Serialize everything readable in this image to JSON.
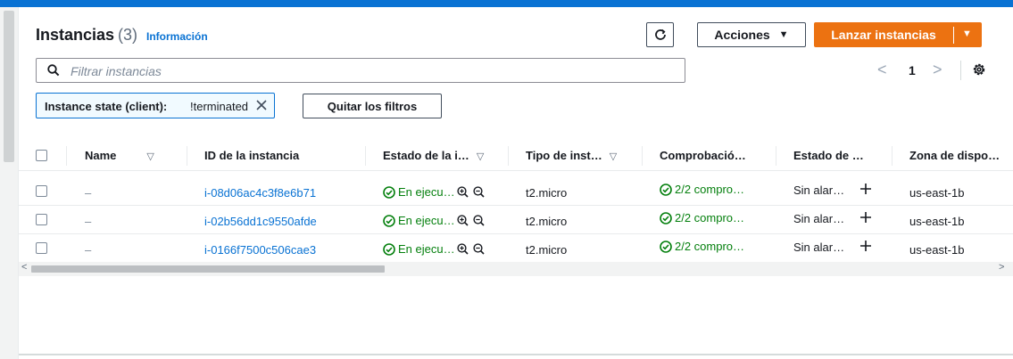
{
  "header": {
    "title": "Instancias",
    "count": "(3)",
    "info_link": "Información"
  },
  "toolbar": {
    "refresh_icon": "refresh-icon",
    "actions_label": "Acciones",
    "launch_label": "Lanzar instancias"
  },
  "search": {
    "placeholder": "Filtrar instancias",
    "value": ""
  },
  "pagination": {
    "current_page": "1"
  },
  "filter_token": {
    "key": "Instance state (client):",
    "value": "!terminated"
  },
  "clear_filters_label": "Quitar los filtros",
  "table": {
    "columns": [
      {
        "label": "Name"
      },
      {
        "label": "ID de la instancia"
      },
      {
        "label": "Estado de la i…"
      },
      {
        "label": "Tipo de inst…"
      },
      {
        "label": "Comprobació…"
      },
      {
        "label": "Estado de …"
      },
      {
        "label": "Zona de dispo…"
      }
    ],
    "rows": [
      {
        "name": "–",
        "id": "i-08d06ac4c3f8e6b71",
        "state": "En ejecu…",
        "type": "t2.micro",
        "check": "2/2 compro…",
        "alarm": "Sin alar…",
        "zone": "us-east-1b"
      },
      {
        "name": "–",
        "id": "i-02b56dd1c9550afde",
        "state": "En ejecu…",
        "type": "t2.micro",
        "check": "2/2 compro…",
        "alarm": "Sin alar…",
        "zone": "us-east-1b"
      },
      {
        "name": "–",
        "id": "i-0166f7500c506cae3",
        "state": "En ejecu…",
        "type": "t2.micro",
        "check": "2/2 compro…",
        "alarm": "Sin alar…",
        "zone": "us-east-1b"
      }
    ]
  },
  "colors": {
    "primary": "#ec7211",
    "link": "#0972d3",
    "success": "#037f0c",
    "top_bar": "#0972d3"
  }
}
